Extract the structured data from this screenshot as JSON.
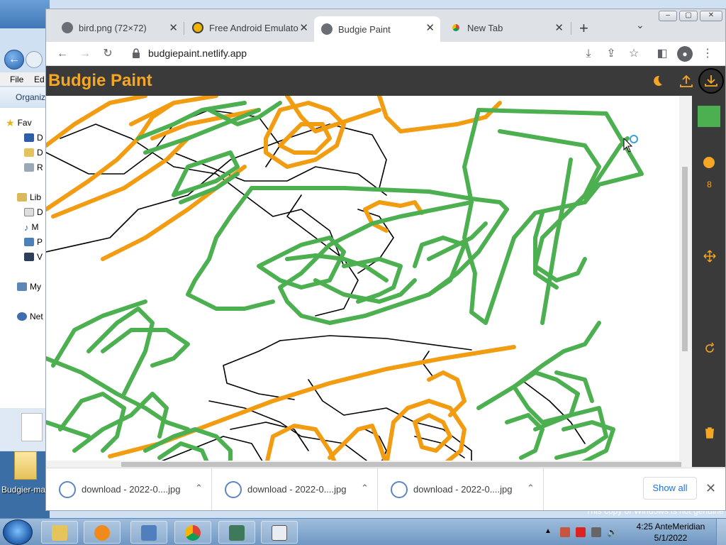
{
  "explorer": {
    "menu": [
      "File",
      "Ed"
    ],
    "command": "Organiz",
    "nav_items": [
      {
        "label": "Fav",
        "icon": "star-icon"
      },
      {
        "label": "D",
        "icon": "desktop-icon"
      },
      {
        "label": "D",
        "icon": "downloads-icon"
      },
      {
        "label": "R",
        "icon": "recent-places-icon"
      },
      {
        "label": "Lib",
        "icon": "libraries-icon"
      },
      {
        "label": "D",
        "icon": "documents-icon"
      },
      {
        "label": "M",
        "icon": "music-icon"
      },
      {
        "label": "P",
        "icon": "pictures-icon"
      },
      {
        "label": "V",
        "icon": "videos-icon"
      },
      {
        "label": "My",
        "icon": "computer-icon"
      },
      {
        "label": "Net",
        "icon": "network-icon"
      }
    ]
  },
  "desktop_icon_label": "Budgier-ma",
  "browser": {
    "tabs": [
      {
        "title": "bird.png (72×72)",
        "icon": "globe-icon",
        "close": "✕"
      },
      {
        "title": "Free Android Emulato",
        "icon": "emulator-icon",
        "close": "✕"
      },
      {
        "title": "Budgie Paint",
        "icon": "globe-icon",
        "close": "✕"
      },
      {
        "title": "New Tab",
        "icon": "chrome-icon",
        "close": "✕"
      }
    ],
    "active_tab": 2,
    "url": "budgiepaint.netlify.app"
  },
  "app": {
    "title": "Budgie Paint",
    "colors": {
      "brand": "#f5a623",
      "header_bg": "#3a3a3a",
      "current_color": "#4caf50"
    },
    "brush_size": "8"
  },
  "downloads": {
    "items": [
      {
        "name": "download - 2022-0....jpg"
      },
      {
        "name": "download - 2022-0....jpg"
      },
      {
        "name": "download - 2022-0....jpg"
      }
    ],
    "show_all": "Show all"
  },
  "taskbar": {
    "genuine_notice": "This copy of Windows is not genuine",
    "time": "4:25 AnteMeridian",
    "date": "5/1/2022"
  }
}
